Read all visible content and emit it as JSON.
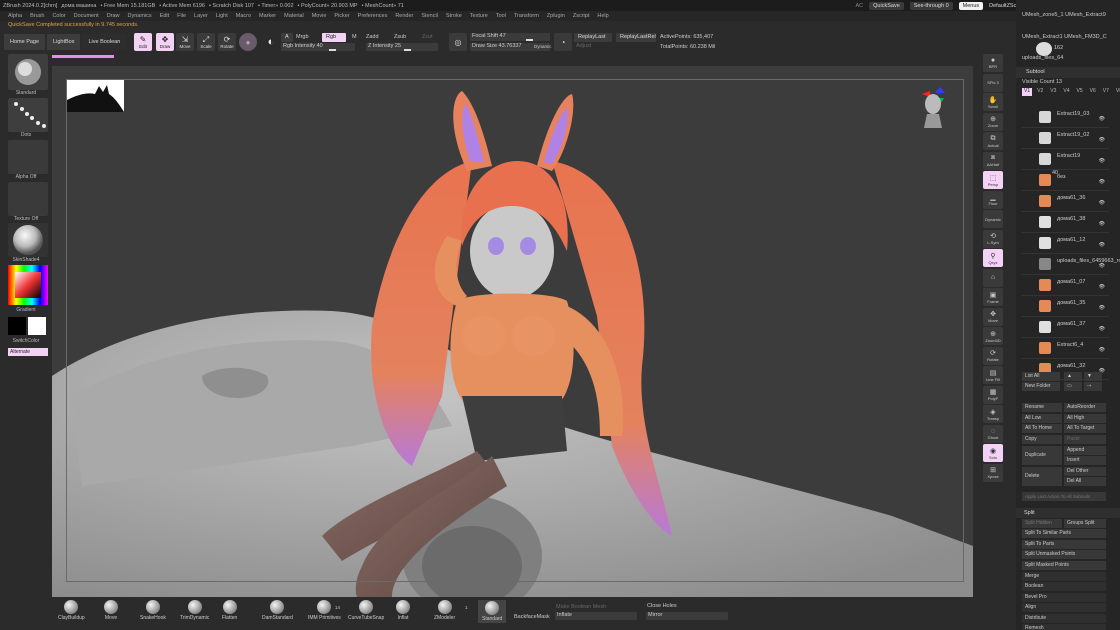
{
  "titlebar": {
    "app": "ZBrush 2024.0.2[chrn]",
    "host": "дома машина",
    "free_mem": "• Free Mem 15.181GB",
    "active_mem": "• Active Mem 6196",
    "scratch_disk": "• Scratch Disk 107",
    "timer": "• Timer» 0.002",
    "polycount": "• PolyCount» 20.903 MP",
    "meshcount": "• MeshCount» 71",
    "ac": "AC",
    "quicksave": "QuickSave",
    "see_through": "See-through 0",
    "menus": "Menus",
    "default_zscript": "DefaultZScript"
  },
  "menus": [
    "Alpha",
    "Brush",
    "Color",
    "Document",
    "Draw",
    "Dynamics",
    "Edit",
    "File",
    "Layer",
    "Light",
    "Macro",
    "Marker",
    "Material",
    "Movie",
    "Picker",
    "Preferences",
    "Render",
    "Stencil",
    "Stroke",
    "Texture",
    "Tool",
    "Transform",
    "Zplugin",
    "Zscript",
    "Help"
  ],
  "status_message": "QuickSave Completed successfully in 9.745 seconds.",
  "tabs": {
    "home": "Home Page",
    "lightbox": "LightBox",
    "live_boolean": "Live Boolean"
  },
  "toolbar": {
    "edit": "Edit",
    "draw": "Draw",
    "move": "Move",
    "scale": "Scale",
    "rotate": "Rotate",
    "a": "A",
    "mrgb": "Mrgb",
    "rgb": "Rgb",
    "m": "M",
    "zadd": "Zadd",
    "zsub": "Zsub",
    "zcut": "Zcut",
    "rgb_intensity": "Rgb Intensity 40",
    "z_intensity": "Z Intensity 25",
    "focal_shift": "Focal Shift 47",
    "draw_size": "Draw Size 43.76337",
    "dynamic": "Dynamic",
    "replay_last": "ReplayLast",
    "replay_last_rel": "ReplayLastRel",
    "adjust": "Adjust",
    "active_points": "ActivePoints: 635,407",
    "total_points": "TotalPoints: 60.238 Mil"
  },
  "left_panel": {
    "standard": "Standard",
    "dots": "Dots",
    "alpha_off": "Alpha Off",
    "texture_off": "Texture Off",
    "material": "SkinShade4",
    "gradient": "Gradient",
    "switch_color": "SwitchColor",
    "alternate": "Alternate"
  },
  "right_tools": [
    "BPR",
    "SPix 3",
    "Scroll",
    "Zoom",
    "Actual",
    "AAHalf",
    "Persp",
    "Floor",
    "Dynamic",
    "L.Sym",
    "Qxyz",
    "",
    "Frame",
    "Move",
    "Zoom3D",
    "Rotate",
    "Line Fill",
    "PolyF",
    "Transp",
    "Ghost",
    "Solo",
    "Xpose"
  ],
  "right_panel": {
    "top_items": [
      "UMesh_zone5_1 UMesh_Extract9",
      "UMesh_Extract1 UMesh_FM3D_C",
      "uploads_files_64"
    ],
    "top_count": "162",
    "subtool_title": "Subtool",
    "visible_count": "Visible Count 13",
    "versions": [
      "V1",
      "V2",
      "V3",
      "V4",
      "V5",
      "V6",
      "V7",
      "V8"
    ],
    "subtools": [
      {
        "name": "Extract19_03",
        "color": "#d8d8d8"
      },
      {
        "name": "Extract19_02",
        "color": "#d8d8d8"
      },
      {
        "name": "Extract19",
        "color": "#d8d8d8"
      },
      {
        "name": "без",
        "color": "#e58a55"
      },
      {
        "name": "дома61_36",
        "color": "#e58a55"
      },
      {
        "name": "дома61_38",
        "color": "#e0e0e0"
      },
      {
        "name": "дома61_12",
        "color": "#e0e0e0"
      },
      {
        "name": "uploads_files_6459663_rose",
        "color": "#888"
      },
      {
        "name": "дома61_07",
        "color": "#e58a55"
      },
      {
        "name": "дома61_35",
        "color": "#e58a55"
      },
      {
        "name": "дома61_37",
        "color": "#e0e0e0"
      },
      {
        "name": "Extract6_4",
        "color": "#e58a55"
      },
      {
        "name": "дома61_32",
        "color": "#e58a55"
      }
    ],
    "count_40": "40",
    "list_all": "List All",
    "new_folder": "New Folder",
    "rename": "Rename",
    "auto_reorder": "AutoReorder",
    "all_low": "All Low",
    "all_high": "All High",
    "all_to_home": "All To Home",
    "all_to_target": "All To Target",
    "copy": "Copy",
    "paste": "Paste",
    "duplicate": "Duplicate",
    "append": "Append",
    "insert": "Insert",
    "delete": "Delete",
    "del_other": "Del Other",
    "del_all": "Del All",
    "apply_last_action": "Apply Last Action To All Subtools",
    "split_title": "Split",
    "split_hidden": "Split Hidden",
    "groups_split": "Groups Split",
    "split_similar": "Split To Similar Parts",
    "split_parts": "Split To Parts",
    "split_unmasked": "Split Unmasked Points",
    "split_masked": "Split Masked Points",
    "merge": "Merge",
    "boolean": "Boolean",
    "bevel_pro": "Bevel Pro",
    "align": "Align",
    "distribute": "Distribute",
    "remesh": "Remesh"
  },
  "bottom_brushes": [
    "ClayBuildup",
    "Move",
    "SnakeHook",
    "TrimDynamic",
    "Flatten",
    "DamStandard",
    "IMM Primitives",
    "CurveTubeSnap",
    "Inflat",
    "ZModeler",
    "Standard"
  ],
  "bottom_right": {
    "imm_count": "14",
    "zmodeler_count": "1",
    "backface_mask": "BackfaceMask",
    "make_boolean": "Make Boolean Mesh",
    "inflate": "Inflate",
    "close_holes": "Close Holes",
    "mirror": "Mirror"
  }
}
